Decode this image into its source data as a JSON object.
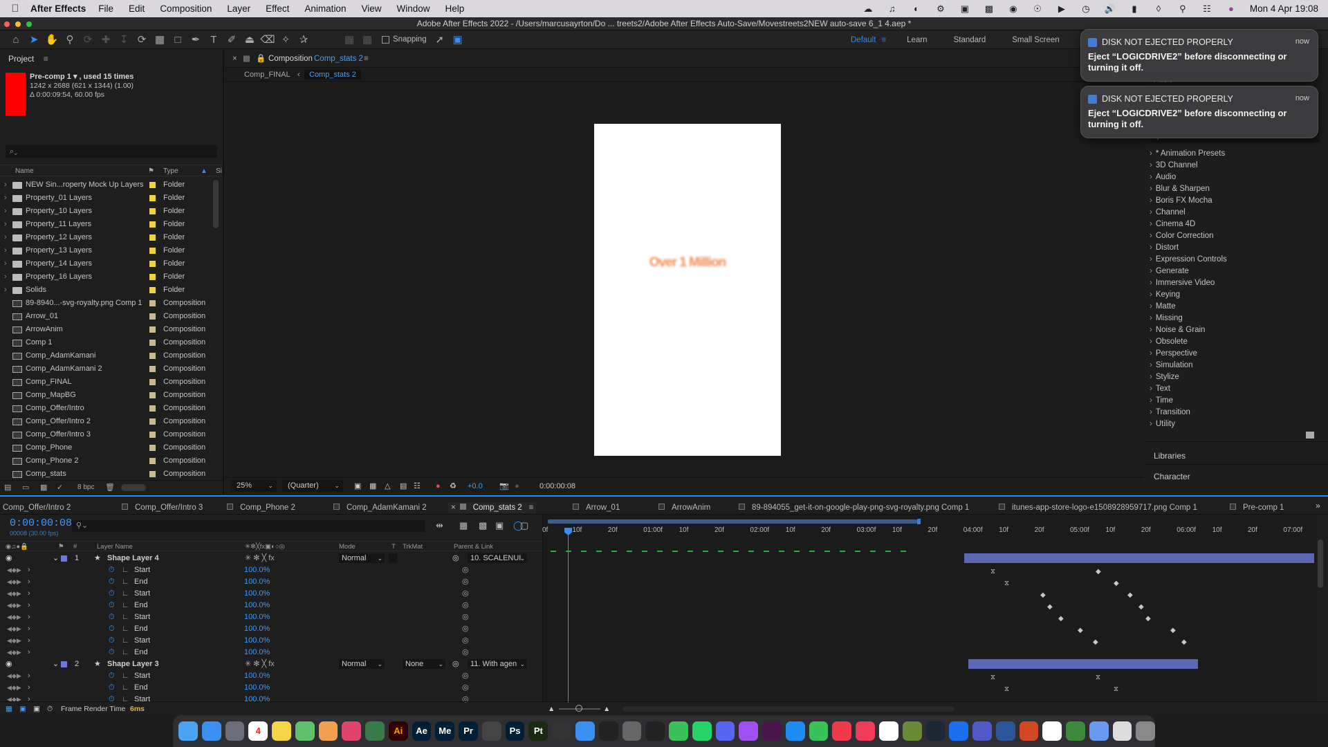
{
  "menubar": {
    "app_name": "After Effects",
    "items": [
      "File",
      "Edit",
      "Composition",
      "Layer",
      "Effect",
      "Animation",
      "View",
      "Window",
      "Help"
    ],
    "clock": "Mon 4 Apr  19:08"
  },
  "titlebar": {
    "title": "Adobe After Effects 2022 - /Users/marcusayrton/Do ... treets2/Adobe After Effects Auto-Save/Movestreets2NEW auto-save 6_1 4.aep *"
  },
  "toolbar": {
    "snapping_label": "Snapping",
    "workspaces": [
      "Default",
      "Learn",
      "Standard",
      "Small Screen"
    ],
    "active_workspace": "Default"
  },
  "project": {
    "title": "Project",
    "thumb_color": "#ff0000",
    "info_name": "Pre-comp 1 ▾ , used 15 times",
    "info_dims": "1242 x 2688  (621 x 1344) (1.00)",
    "info_duration": "Δ 0:00:09:54, 60.00 fps",
    "search_placeholder": "⌕⌄",
    "col_name": "Name",
    "col_type": "Type",
    "col_size": "Si",
    "items": [
      {
        "name": "NEW Sin...roperty Mock Up Layers",
        "type": "Folder",
        "kind": "folder"
      },
      {
        "name": "Property_01 Layers",
        "type": "Folder",
        "kind": "folder"
      },
      {
        "name": "Property_10 Layers",
        "type": "Folder",
        "kind": "folder"
      },
      {
        "name": "Property_11 Layers",
        "type": "Folder",
        "kind": "folder"
      },
      {
        "name": "Property_12 Layers",
        "type": "Folder",
        "kind": "folder"
      },
      {
        "name": "Property_13 Layers",
        "type": "Folder",
        "kind": "folder"
      },
      {
        "name": "Property_14 Layers",
        "type": "Folder",
        "kind": "folder"
      },
      {
        "name": "Property_16 Layers",
        "type": "Folder",
        "kind": "folder"
      },
      {
        "name": "Solids",
        "type": "Folder",
        "kind": "folder"
      },
      {
        "name": "89-8940...-svg-royalty.png Comp 1",
        "type": "Composition",
        "kind": "comp"
      },
      {
        "name": "Arrow_01",
        "type": "Composition",
        "kind": "comp"
      },
      {
        "name": "ArrowAnim",
        "type": "Composition",
        "kind": "comp"
      },
      {
        "name": "Comp 1",
        "type": "Composition",
        "kind": "comp"
      },
      {
        "name": "Comp_AdamKamani",
        "type": "Composition",
        "kind": "comp"
      },
      {
        "name": "Comp_AdamKamani 2",
        "type": "Composition",
        "kind": "comp"
      },
      {
        "name": "Comp_FINAL",
        "type": "Composition",
        "kind": "comp"
      },
      {
        "name": "Comp_MapBG",
        "type": "Composition",
        "kind": "comp"
      },
      {
        "name": "Comp_Offer/Intro",
        "type": "Composition",
        "kind": "comp"
      },
      {
        "name": "Comp_Offer/Intro 2",
        "type": "Composition",
        "kind": "comp"
      },
      {
        "name": "Comp_Offer/Intro 3",
        "type": "Composition",
        "kind": "comp"
      },
      {
        "name": "Comp_Phone",
        "type": "Composition",
        "kind": "comp"
      },
      {
        "name": "Comp_Phone 2",
        "type": "Composition",
        "kind": "comp"
      },
      {
        "name": "Comp_stats",
        "type": "Composition",
        "kind": "comp"
      }
    ],
    "bpc": "8 bpc"
  },
  "composition": {
    "panel_label": "Composition",
    "comp_name": "Comp_stats 2",
    "breadcrumb": [
      "Comp_FINAL",
      "Comp_stats 2"
    ],
    "canvas_text": "Over 1 Million",
    "zoom": "25%",
    "resolution": "(Quarter)",
    "exposure": "+0.0",
    "timecode": "0:00:00:08"
  },
  "effects": {
    "items": [
      "* Animation Presets",
      "3D Channel",
      "Audio",
      "Blur & Sharpen",
      "Boris FX Mocha",
      "Channel",
      "Cinema 4D",
      "Color Correction",
      "Distort",
      "Expression Controls",
      "Generate",
      "Immersive Video",
      "Keying",
      "Matte",
      "Missing",
      "Noise & Grain",
      "Obsolete",
      "Perspective",
      "Simulation",
      "Stylize",
      "Text",
      "Time",
      "Transition",
      "Utility"
    ],
    "audio_label": "Audio",
    "libraries": "Libraries",
    "character": "Character"
  },
  "notifications": [
    {
      "title": "DISK NOT EJECTED PROPERLY",
      "when": "now",
      "body": "Eject “LOGICDRIVE2” before disconnecting or turning it off."
    },
    {
      "title": "DISK NOT EJECTED PROPERLY",
      "when": "now",
      "body": "Eject “LOGICDRIVE2” before disconnecting or turning it off."
    }
  ],
  "timeline": {
    "tabs": [
      "Comp_Offer/Intro 2",
      "Comp_Offer/Intro 3",
      "Comp_Phone 2",
      "Comp_AdamKamani 2",
      "Comp_stats 2",
      "Arrow_01",
      "ArrowAnim",
      "89-894055_get-it-on-google-play-png-svg-royalty.png Comp 1",
      "itunes-app-store-logo-e1508928959717.png Comp 1",
      "Pre-comp 1"
    ],
    "active_tab": "Comp_stats 2",
    "current_time": "0:00:00:08",
    "frame_info": "00008 (30.00 fps)",
    "col_layer_name": "Layer Name",
    "col_mode": "Mode",
    "col_t": "T",
    "col_trkmat": "TrkMat",
    "col_parent": "Parent & Link",
    "ruler": [
      "0f",
      "10f",
      "20f",
      "01:00f",
      "10f",
      "20f",
      "02:00f",
      "10f",
      "20f",
      "03:00f",
      "10f",
      "20f",
      "04:00f",
      "10f",
      "20f",
      "05:00f",
      "10f",
      "20f",
      "06:00f",
      "10f",
      "20f",
      "07:00f"
    ],
    "layers": [
      {
        "num": "1",
        "name": "Shape Layer 4",
        "mode": "Normal",
        "trkmat": "",
        "parent": "10. SCALENUI",
        "props": [
          {
            "name": "Start",
            "value": "100.0%"
          },
          {
            "name": "End",
            "value": "100.0%"
          },
          {
            "name": "Start",
            "value": "100.0%"
          },
          {
            "name": "End",
            "value": "100.0%"
          },
          {
            "name": "Start",
            "value": "100.0%"
          },
          {
            "name": "End",
            "value": "100.0%"
          },
          {
            "name": "Start",
            "value": "100.0%"
          },
          {
            "name": "End",
            "value": "100.0%"
          }
        ]
      },
      {
        "num": "2",
        "name": "Shape Layer 3",
        "mode": "Normal",
        "trkmat": "None",
        "parent": "11. With agen",
        "props": [
          {
            "name": "Start",
            "value": "100.0%"
          },
          {
            "name": "End",
            "value": "100.0%"
          },
          {
            "name": "Start",
            "value": "100.0%"
          }
        ]
      }
    ],
    "render_label": "Frame Render Time",
    "render_value": "6ms"
  },
  "dock": {
    "apps": [
      "Finder",
      "Mail",
      "Launchpad",
      "Calendar",
      "Notes",
      "Maps",
      "Photos",
      "Creative Cloud",
      "Mocha",
      "Ai",
      "Ae",
      "Me",
      "Pr",
      "Help",
      "Ps",
      "Pt",
      "Cinema",
      "Safari",
      "TV",
      "Settings",
      "Unity",
      "Messages",
      "WhatsApp",
      "Discord",
      "Messenger",
      "Slack",
      "App Store",
      "FaceTime",
      "News",
      "Music",
      "Chrome",
      "Minecraft",
      "Steam",
      "TeamViewer",
      "Teams",
      "Word",
      "PowerPoint",
      "Chrome2",
      "Drive",
      "Preview",
      "Files",
      "Trash"
    ],
    "calendar_day": "4"
  }
}
